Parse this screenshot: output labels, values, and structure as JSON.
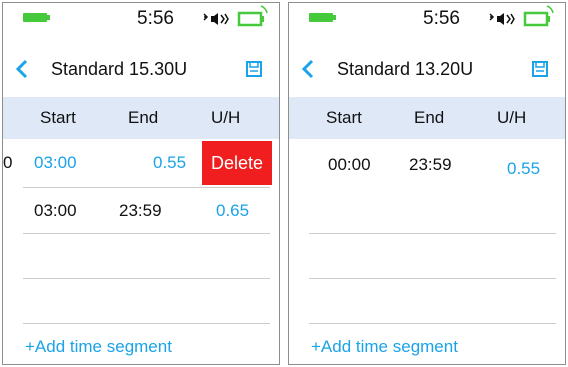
{
  "colors": {
    "accent": "#1aa3e8",
    "header_bg": "#dfe8f7",
    "delete_bg": "#f01e1e",
    "battery": "#46c93a"
  },
  "icons": {
    "back": "chevron-left",
    "save": "floppy-disk",
    "sound": "speaker-mute",
    "battery": "battery-outline"
  },
  "left": {
    "status": {
      "time": "5:56"
    },
    "title": "Standard 15.30U",
    "headers": {
      "start": "Start",
      "end": "End",
      "rate": "U/H"
    },
    "rows": [
      {
        "start": "0",
        "end": "03:00",
        "rate": "0.55",
        "action": "Delete"
      },
      {
        "start": "03:00",
        "end": "23:59",
        "rate": "0.65"
      }
    ],
    "add_segment": "+Add time segment"
  },
  "right": {
    "status": {
      "time": "5:56"
    },
    "title": "Standard 13.20U",
    "headers": {
      "start": "Start",
      "end": "End",
      "rate": "U/H"
    },
    "rows": [
      {
        "start": "00:00",
        "end": "23:59",
        "rate": "0.55"
      }
    ],
    "add_segment": "+Add time segment"
  }
}
